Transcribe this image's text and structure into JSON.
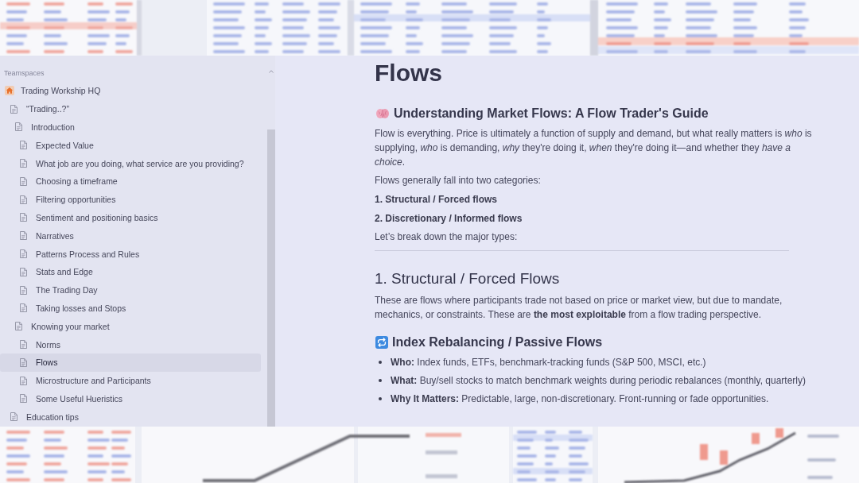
{
  "sidebar": {
    "section_label": "Teamspaces",
    "tree": [
      {
        "kind": "workspace",
        "label": "Trading Workship HQ",
        "selected": false,
        "children": [
          {
            "kind": "page",
            "label": "“Trading..?”",
            "selected": false,
            "children": [
              {
                "kind": "page",
                "label": "Introduction",
                "selected": false,
                "children": [
                  {
                    "kind": "page",
                    "label": "Expected Value",
                    "selected": false
                  },
                  {
                    "kind": "page",
                    "label": "What job are you doing, what service are you providing?",
                    "selected": false
                  },
                  {
                    "kind": "page",
                    "label": "Choosing a timeframe",
                    "selected": false
                  },
                  {
                    "kind": "page",
                    "label": "Filtering opportunities",
                    "selected": false
                  },
                  {
                    "kind": "page",
                    "label": "Sentiment and positioning basics",
                    "selected": false
                  },
                  {
                    "kind": "page",
                    "label": "Narratives",
                    "selected": false
                  },
                  {
                    "kind": "page",
                    "label": "Patterns Process and Rules",
                    "selected": false
                  },
                  {
                    "kind": "page",
                    "label": "Stats and Edge",
                    "selected": false
                  },
                  {
                    "kind": "page",
                    "label": "The Trading Day",
                    "selected": false
                  },
                  {
                    "kind": "page",
                    "label": "Taking losses and Stops",
                    "selected": false
                  }
                ]
              },
              {
                "kind": "page",
                "label": "Knowing your market",
                "selected": false,
                "children": [
                  {
                    "kind": "page",
                    "label": "Norms",
                    "selected": false
                  },
                  {
                    "kind": "page",
                    "label": "Flows",
                    "selected": true
                  },
                  {
                    "kind": "page",
                    "label": "Microstructure and Participants",
                    "selected": false
                  },
                  {
                    "kind": "page",
                    "label": "Some Useful Hueristics",
                    "selected": false
                  }
                ]
              }
            ]
          },
          {
            "kind": "page",
            "label": "Education tips",
            "selected": false
          }
        ]
      }
    ]
  },
  "page": {
    "title": "Flows",
    "blocks": [
      {
        "kind": "guide",
        "text": "Understanding Market Flows: A Flow Trader's Guide"
      },
      {
        "kind": "paragraph",
        "text": "Flow is everything. Price is ultimately a function of supply and demand, but what really matters is *who* is supplying, *who* is demanding, *why* they're doing it, *when* they're doing it—and whether they *have a choice*."
      },
      {
        "kind": "paragraph",
        "text": "Flows generally fall into two categories:"
      },
      {
        "kind": "label",
        "text": "1. Structural / Forced flows"
      },
      {
        "kind": "label",
        "text": "2. Discretionary / Informed flows"
      },
      {
        "kind": "paragraph",
        "text": "Let’s break down the major types:"
      },
      {
        "kind": "divider"
      },
      {
        "kind": "section",
        "text": "1. Structural / Forced Flows"
      },
      {
        "kind": "paragraph",
        "text": "These are flows where participants trade not based on price or market view, but due to mandate, mechanics, or constraints. These are **the most exploitable** from a flow trading perspective."
      },
      {
        "kind": "topic",
        "text": "Index Rebalancing / Passive Flows"
      },
      {
        "kind": "bullet",
        "text": "**Who:** Index funds, ETFs, benchmark-tracking funds (S&P 500, MSCI, etc.)"
      },
      {
        "kind": "bullet",
        "text": "**What:** Buy/sell stocks to match benchmark weights during periodic rebalances (monthly, quarterly)"
      },
      {
        "kind": "bullet",
        "text": "**Why It Matters:** Predictable, large, non-discretionary. Front-running or fade opportunities."
      }
    ]
  }
}
